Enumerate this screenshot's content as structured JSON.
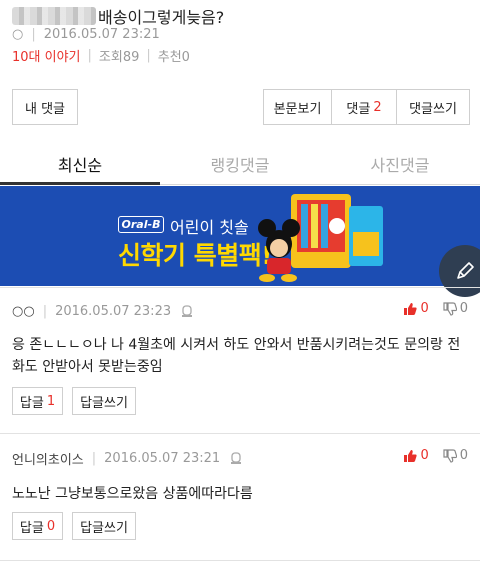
{
  "post": {
    "title": "배송이그렇게늦음?",
    "author_icon": "○",
    "date": "2016.05.07 23:21",
    "category": "10대 이야기",
    "views_label": "조회89",
    "recommend_label": "추천0"
  },
  "buttons": {
    "my_comments": "내 댓글",
    "view_post": "본문보기",
    "comments_label": "댓글",
    "comments_count": "2",
    "write_comment": "댓글쓰기"
  },
  "tabs": [
    "최신순",
    "랭킹댓글",
    "사진댓글"
  ],
  "banner": {
    "brand": "Oral-B",
    "line1": "어린이 칫솔",
    "line2": "신학기 특별팩!"
  },
  "comments": [
    {
      "nick": "○○",
      "date": "2016.05.07 23:23",
      "up": "0",
      "down": "0",
      "body": "응 존ㄴㄴㄴㅇ나 나 4월초에 시켜서 하도 안와서 반품시키려는것도 문의랑 전화도 안받아서 못받는중임",
      "reply_label": "답글",
      "reply_count": "1",
      "write_reply": "답글쓰기"
    },
    {
      "nick": "언니의초이스",
      "date": "2016.05.07 23:21",
      "up": "0",
      "down": "0",
      "body": "노노난 그냥보통으로왔음 상품에따라다름",
      "reply_label": "답글",
      "reply_count": "0",
      "write_reply": "답글쓰기"
    }
  ],
  "colors": {
    "accent_red": "#e8302a",
    "banner_blue": "#1c4db3",
    "banner_yellow": "#ffd800",
    "fab_bg": "#2f3e52"
  },
  "icons": {
    "fab": "pencil-icon",
    "flag": "report-flag-icon",
    "up": "thumb-up-icon",
    "down": "thumb-down-icon"
  }
}
